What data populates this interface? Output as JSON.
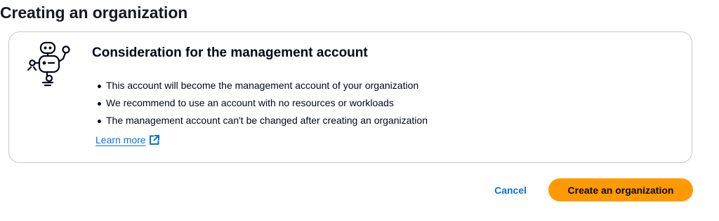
{
  "page": {
    "title": "Creating an organization"
  },
  "card": {
    "illustration_icon": "robot-icon",
    "title": "Consideration for the management account",
    "bullets": [
      "This account will become the management account of your organization",
      "We recommend to use an account with no resources or workloads",
      "The management account can't be changed after creating an organization"
    ],
    "learn_more_label": "Learn more",
    "learn_more_icon": "external-link-icon"
  },
  "actions": {
    "cancel_label": "Cancel",
    "primary_label": "Create an organization"
  },
  "colors": {
    "link": "#0972d3",
    "primary_button": "#ff9900",
    "text": "#000716",
    "card_border": "#c6c6cd"
  }
}
